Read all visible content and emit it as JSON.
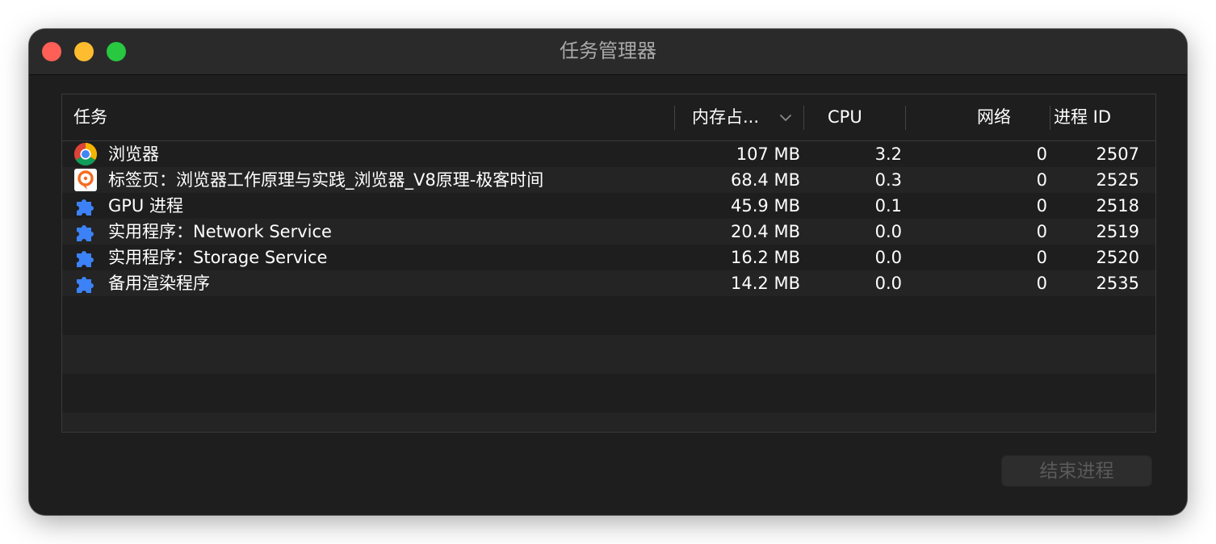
{
  "window": {
    "title": "任务管理器"
  },
  "table": {
    "columns": [
      {
        "key": "task",
        "label": "任务"
      },
      {
        "key": "memory",
        "label": "内存占..."
      },
      {
        "key": "cpu",
        "label": "CPU"
      },
      {
        "key": "network",
        "label": "网络"
      },
      {
        "key": "pid",
        "label": "进程 ID"
      }
    ],
    "sort_icon": "chevron-down-icon",
    "rows": [
      {
        "icon": "chrome-icon",
        "task": "浏览器",
        "memory": "107 MB",
        "cpu": "3.2",
        "network": "0",
        "pid": "2507"
      },
      {
        "icon": "geektime-icon",
        "task": "标签页：浏览器工作原理与实践_浏览器_V8原理-极客时间",
        "memory": "68.4 MB",
        "cpu": "0.3",
        "network": "0",
        "pid": "2525"
      },
      {
        "icon": "puzzle-icon",
        "task": "GPU 进程",
        "memory": "45.9 MB",
        "cpu": "0.1",
        "network": "0",
        "pid": "2518"
      },
      {
        "icon": "puzzle-icon",
        "task": "实用程序：Network Service",
        "memory": "20.4 MB",
        "cpu": "0.0",
        "network": "0",
        "pid": "2519"
      },
      {
        "icon": "puzzle-icon",
        "task": "实用程序：Storage Service",
        "memory": "16.2 MB",
        "cpu": "0.0",
        "network": "0",
        "pid": "2520"
      },
      {
        "icon": "puzzle-icon",
        "task": "备用渲染程序",
        "memory": "14.2 MB",
        "cpu": "0.0",
        "network": "0",
        "pid": "2535"
      }
    ]
  },
  "footer": {
    "end_process_label": "结束进程"
  },
  "colors": {
    "background": "#1e1e1e",
    "titlebar": "#2a2a2a",
    "row_alt": "#242424",
    "text": "#ffffff",
    "disabled_text": "#5a5a5a",
    "close": "#fe5f57",
    "minimize": "#febc2e",
    "maximize": "#28c840",
    "puzzle_icon": "#3c82f6",
    "geektime_orange": "#f36c21"
  }
}
